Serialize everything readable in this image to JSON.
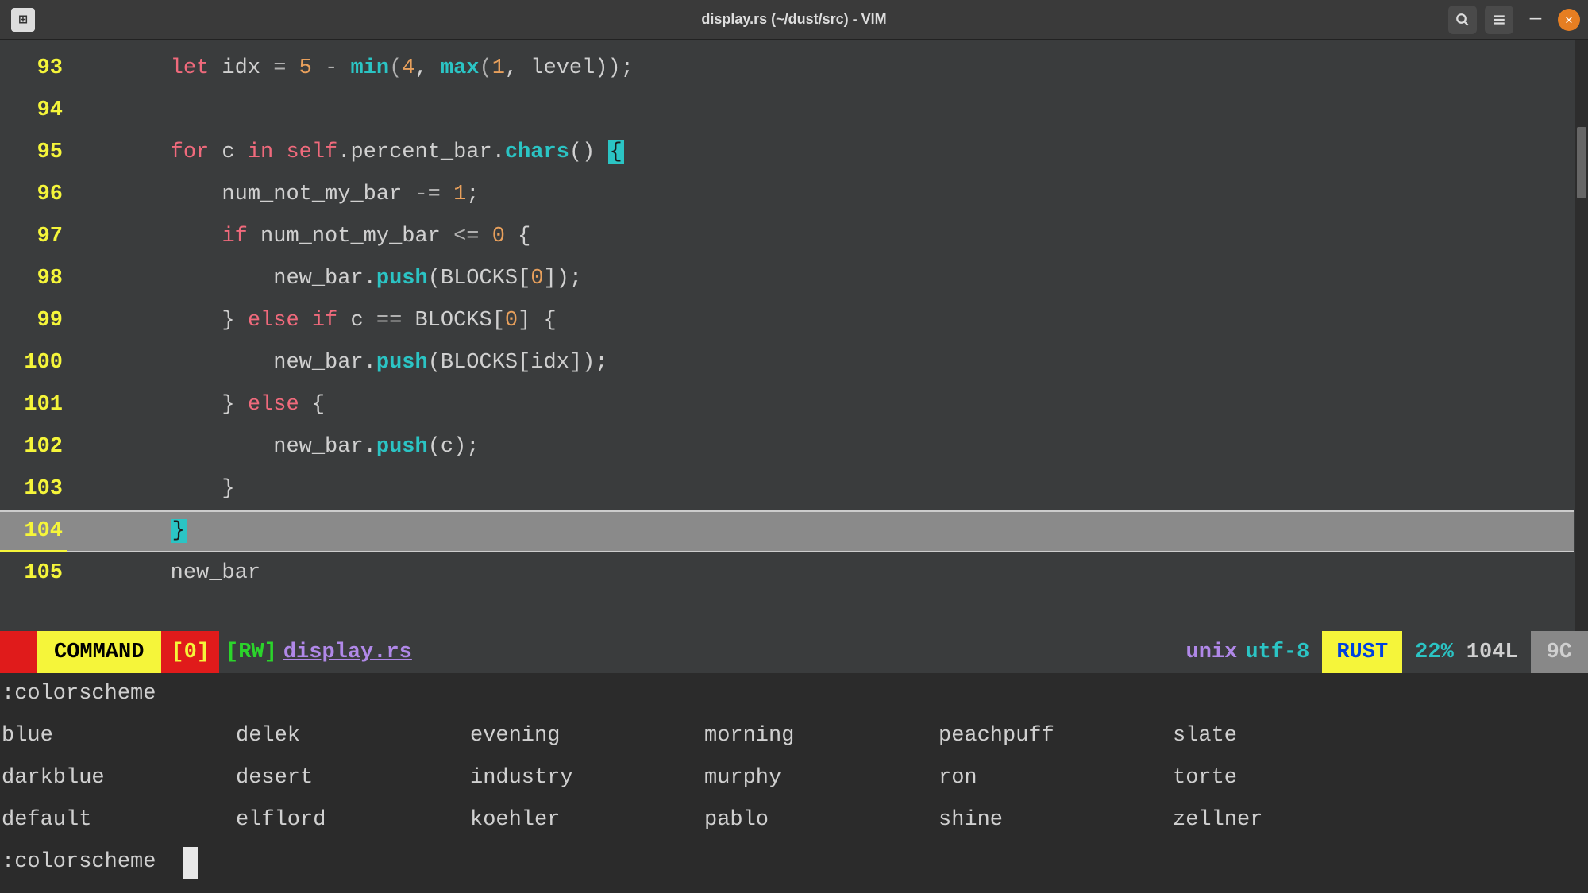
{
  "titlebar": {
    "title": "display.rs (~/dust/src) - VIM",
    "app_glyph": "⊞"
  },
  "gutter_start": 93,
  "lines": [
    {
      "n": 93,
      "tokens": [
        [
          "        ",
          null
        ],
        [
          "let",
          "kw-red"
        ],
        [
          " idx ",
          null
        ],
        [
          "=",
          "op"
        ],
        [
          " ",
          null
        ],
        [
          "5",
          "num"
        ],
        [
          " ",
          null
        ],
        [
          "-",
          "op"
        ],
        [
          " ",
          null
        ],
        [
          "min",
          "kw-teal"
        ],
        [
          "(",
          "op"
        ],
        [
          "4",
          "num"
        ],
        [
          ", ",
          null
        ],
        [
          "max",
          "kw-teal"
        ],
        [
          "(",
          "op"
        ],
        [
          "1",
          "num"
        ],
        [
          ", level));",
          null
        ]
      ]
    },
    {
      "n": 94,
      "tokens": [
        [
          "",
          null
        ]
      ]
    },
    {
      "n": 95,
      "tokens": [
        [
          "        ",
          null
        ],
        [
          "for",
          "kw-red"
        ],
        [
          " c ",
          null
        ],
        [
          "in",
          "kw-red"
        ],
        [
          " ",
          null
        ],
        [
          "self",
          "kw-red"
        ],
        [
          ".percent_bar.",
          null
        ],
        [
          "chars",
          "kw-teal"
        ],
        [
          "() ",
          null
        ],
        [
          "{",
          "brace-match"
        ]
      ]
    },
    {
      "n": 96,
      "tokens": [
        [
          "            num_not_my_bar ",
          null
        ],
        [
          "-=",
          "op"
        ],
        [
          " ",
          null
        ],
        [
          "1",
          "num"
        ],
        [
          ";",
          null
        ]
      ]
    },
    {
      "n": 97,
      "tokens": [
        [
          "            ",
          null
        ],
        [
          "if",
          "kw-red"
        ],
        [
          " num_not_my_bar ",
          null
        ],
        [
          "<=",
          "op"
        ],
        [
          " ",
          null
        ],
        [
          "0",
          "num"
        ],
        [
          " {",
          null
        ]
      ]
    },
    {
      "n": 98,
      "tokens": [
        [
          "                new_bar.",
          null
        ],
        [
          "push",
          "kw-teal"
        ],
        [
          "(BLOCKS[",
          null
        ],
        [
          "0",
          "num"
        ],
        [
          "]);",
          null
        ]
      ]
    },
    {
      "n": 99,
      "tokens": [
        [
          "            } ",
          null
        ],
        [
          "else",
          "kw-red"
        ],
        [
          " ",
          null
        ],
        [
          "if",
          "kw-red"
        ],
        [
          " c ",
          null
        ],
        [
          "==",
          "op"
        ],
        [
          " BLOCKS[",
          null
        ],
        [
          "0",
          "num"
        ],
        [
          "] {",
          null
        ]
      ]
    },
    {
      "n": 100,
      "tokens": [
        [
          "                new_bar.",
          null
        ],
        [
          "push",
          "kw-teal"
        ],
        [
          "(BLOCKS[idx]);",
          null
        ]
      ]
    },
    {
      "n": 101,
      "tokens": [
        [
          "            } ",
          null
        ],
        [
          "else",
          "kw-red"
        ],
        [
          " {",
          null
        ]
      ]
    },
    {
      "n": 102,
      "tokens": [
        [
          "                new_bar.",
          null
        ],
        [
          "push",
          "kw-teal"
        ],
        [
          "(c);",
          null
        ]
      ]
    },
    {
      "n": 103,
      "tokens": [
        [
          "            }",
          null
        ]
      ]
    },
    {
      "n": 104,
      "tokens": [
        [
          "        ",
          null
        ],
        [
          "}",
          "brace-match"
        ]
      ],
      "highlighted": true
    },
    {
      "n": 105,
      "tokens": [
        [
          "        new_bar",
          null
        ]
      ]
    }
  ],
  "status": {
    "mode": "COMMAND",
    "bufnum": "[0]",
    "rw": "[RW]",
    "filename": "display.rs",
    "fileformat": "unix",
    "encoding": "utf-8",
    "filetype": "RUST",
    "percent": "22%",
    "lines": "104L",
    "col": "9C"
  },
  "command_label": ":colorscheme",
  "completions": [
    [
      "blue",
      "delek",
      "evening",
      "morning",
      "peachpuff",
      "slate"
    ],
    [
      "darkblue",
      "desert",
      "industry",
      "murphy",
      "ron",
      "torte"
    ],
    [
      "default",
      "elflord",
      "koehler",
      "pablo",
      "shine",
      "zellner"
    ]
  ],
  "command_input": ":colorscheme "
}
